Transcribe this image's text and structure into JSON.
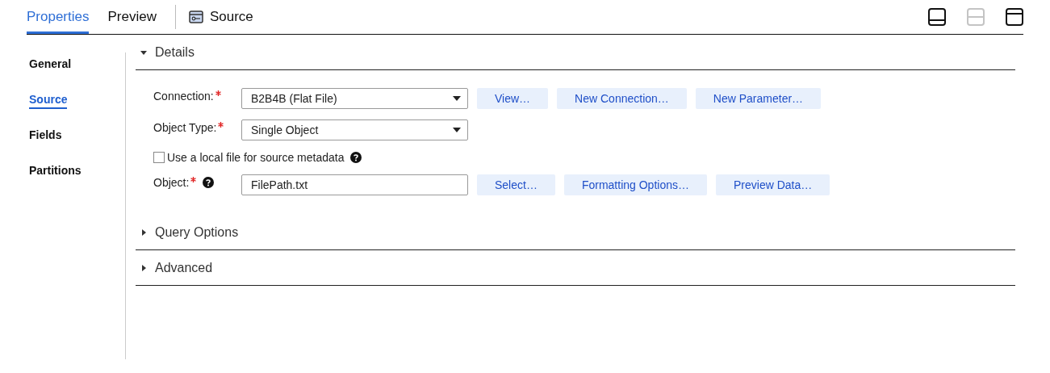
{
  "tabs": [
    {
      "label": "Properties",
      "selected": true
    },
    {
      "label": "Preview",
      "selected": false
    }
  ],
  "source_tab": {
    "label": "Source"
  },
  "layout_buttons": [
    {
      "kind": "bottom",
      "disabled": false
    },
    {
      "kind": "split",
      "disabled": true
    },
    {
      "kind": "top",
      "disabled": false
    }
  ],
  "sidebar": {
    "items": [
      {
        "label": "General",
        "selected": false
      },
      {
        "label": "Source",
        "selected": true
      },
      {
        "label": "Fields",
        "selected": false
      },
      {
        "label": "Partitions",
        "selected": false
      }
    ]
  },
  "sections": [
    {
      "title": "Details",
      "expanded": true,
      "rows": [
        {
          "kind": "select",
          "label": "Connection:",
          "required": true,
          "help": false,
          "value": "B2B4B (Flat File)",
          "buttons": [
            "View…",
            "New Connection…",
            "New Parameter…"
          ]
        },
        {
          "kind": "select",
          "label": "Object Type:",
          "required": true,
          "help": false,
          "value": "Single Object",
          "buttons": []
        },
        {
          "kind": "checkbox",
          "label": "Use a local file for source metadata",
          "checked": false,
          "help": true
        },
        {
          "kind": "text",
          "label": "Object:",
          "required": true,
          "help": true,
          "value": "FilePath.txt",
          "buttons": [
            "Select…",
            "Formatting Options…",
            "Preview Data…"
          ]
        }
      ]
    },
    {
      "title": "Query Options",
      "expanded": false
    },
    {
      "title": "Advanced",
      "expanded": false
    }
  ]
}
